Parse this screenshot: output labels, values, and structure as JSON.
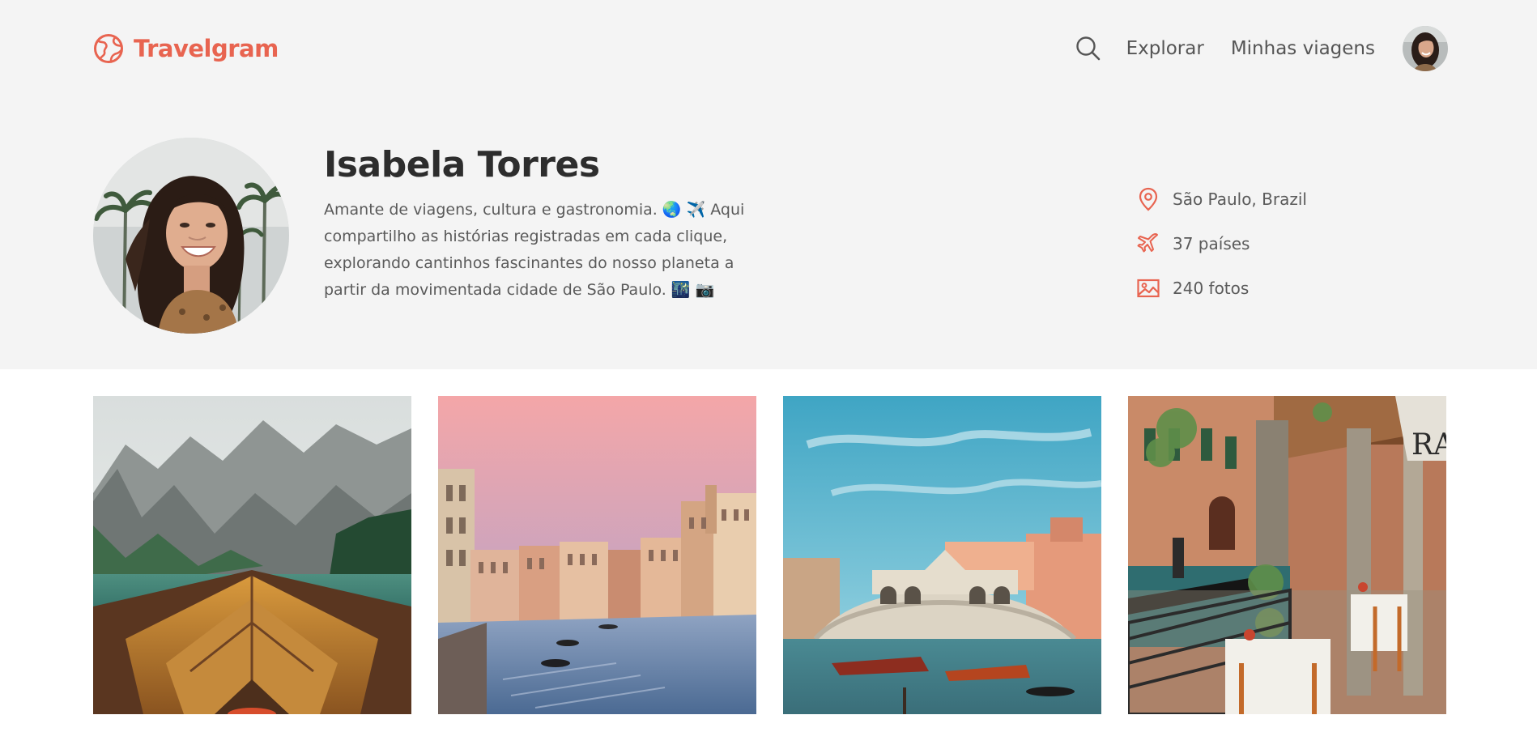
{
  "brand": {
    "name": "Travelgram",
    "color": "#e86450",
    "logo_icon": "globe-icon"
  },
  "nav": {
    "search_icon": "search-icon",
    "links": [
      {
        "label": "Explorar"
      },
      {
        "label": "Minhas viagens"
      }
    ],
    "avatar": "user-avatar"
  },
  "profile": {
    "name": "Isabela Torres",
    "bio": "Amante de viagens, cultura e gastronomia. 🌏 ✈️ Aqui compartilho as histórias registradas em cada clique, explorando cantinhos fascinantes do nosso planeta a partir da movimentada cidade de São Paulo. 🌃 📷",
    "stats": {
      "location": {
        "icon": "map-pin-icon",
        "text": "São Paulo, Brazil"
      },
      "countries": {
        "icon": "airplane-icon",
        "text": "37 países"
      },
      "photos": {
        "icon": "image-icon",
        "text": "240 fotos"
      }
    }
  },
  "gallery": [
    {
      "subject": "boat-on-mountain-lake"
    },
    {
      "subject": "venice-canal-sunset"
    },
    {
      "subject": "rialto-bridge-venice"
    },
    {
      "subject": "venice-canal-cafe"
    }
  ],
  "colors": {
    "accent": "#e86450",
    "header_bg": "#f4f4f4",
    "text": "#333333"
  }
}
